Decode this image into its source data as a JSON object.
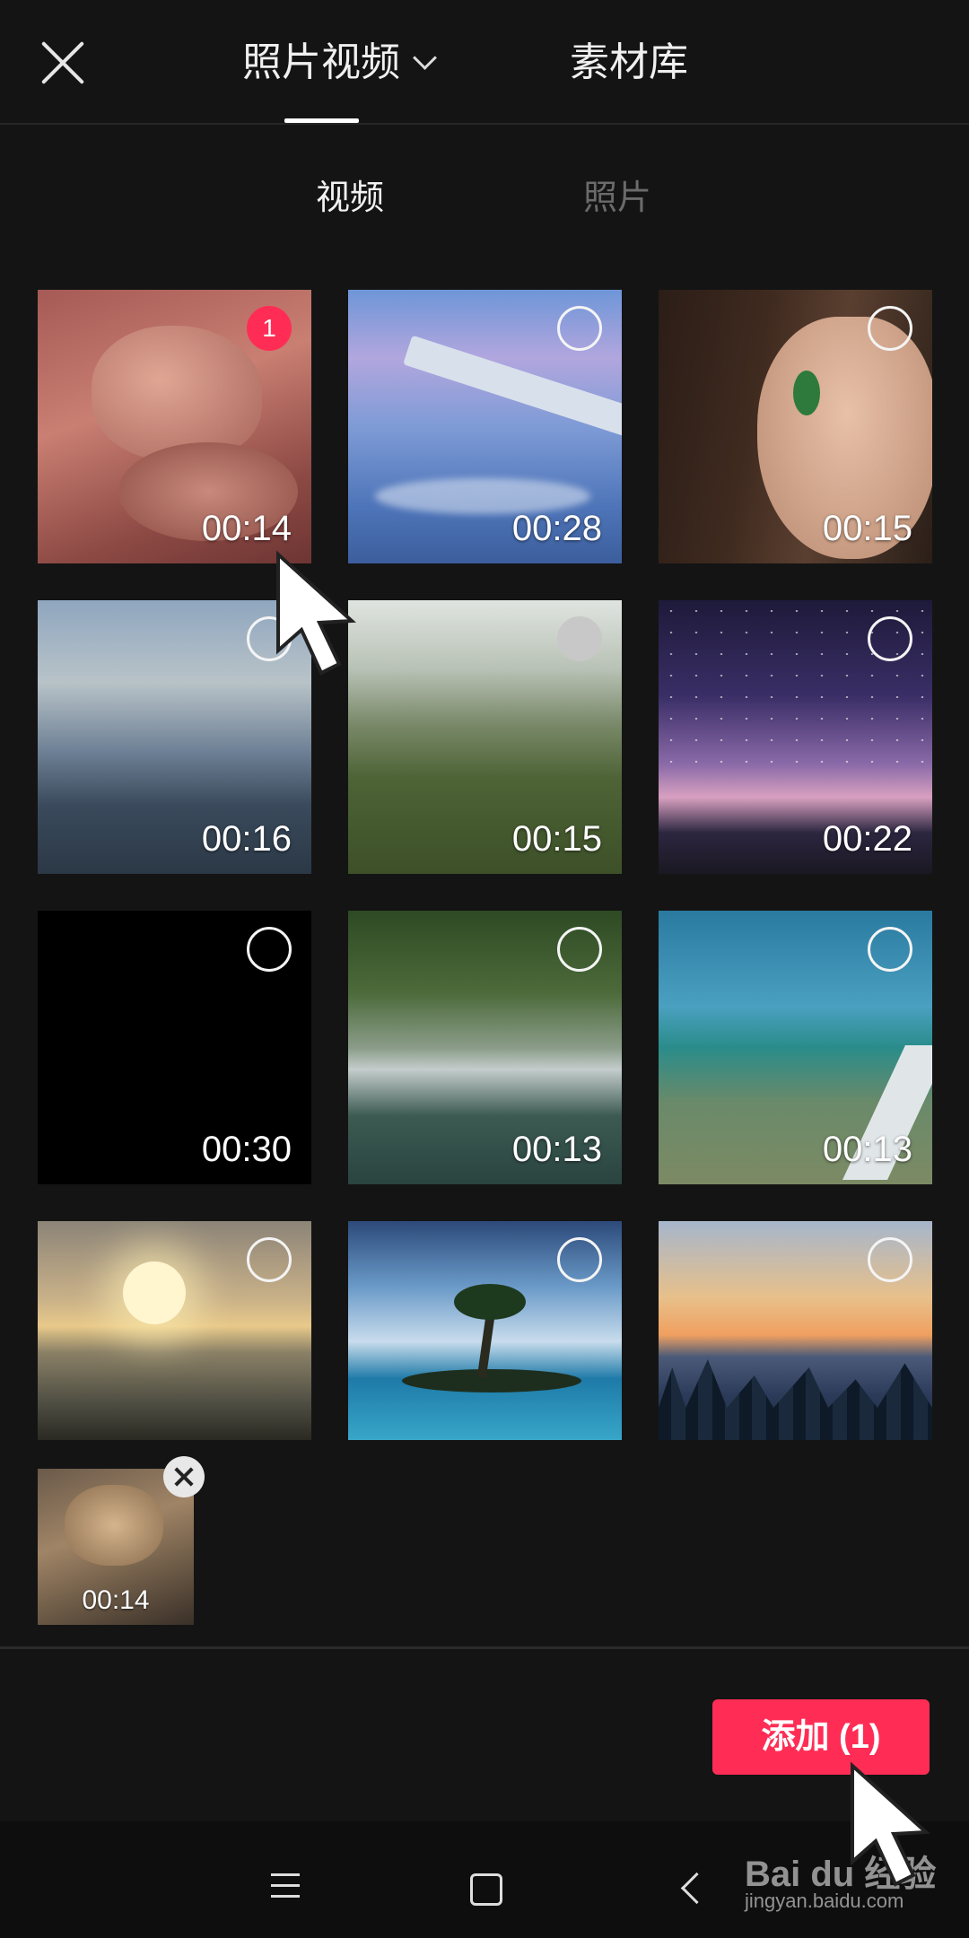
{
  "header": {
    "tabs": [
      {
        "label": "照片视频",
        "active": true
      },
      {
        "label": "素材库",
        "active": false
      }
    ]
  },
  "subtabs": [
    {
      "label": "视频",
      "active": true
    },
    {
      "label": "照片",
      "active": false
    }
  ],
  "media": [
    {
      "duration": "00:14",
      "selected": true,
      "order": "1",
      "scene": "bearded dragon lizard (red tinted, selected)"
    },
    {
      "duration": "00:28",
      "selected": false,
      "scene": "airplane wing above clouds"
    },
    {
      "duration": "00:15",
      "selected": false,
      "scene": "woman with face paint"
    },
    {
      "duration": "00:16",
      "selected": false,
      "scene": "aerial landscape with haze"
    },
    {
      "duration": "00:15",
      "selected": false,
      "scene": "misty green field and hills"
    },
    {
      "duration": "00:22",
      "selected": false,
      "scene": "starry night sky"
    },
    {
      "duration": "00:30",
      "selected": false,
      "scene": "black frame"
    },
    {
      "duration": "00:13",
      "selected": false,
      "scene": "forest waterfall"
    },
    {
      "duration": "00:13",
      "selected": false,
      "scene": "coastline with pier"
    },
    {
      "duration": "",
      "selected": false,
      "scene": "sunset over sea"
    },
    {
      "duration": "",
      "selected": false,
      "scene": "palm island in sea"
    },
    {
      "duration": "",
      "selected": false,
      "scene": "mountains at dusk with pines"
    }
  ],
  "tray": {
    "duration": "00:14"
  },
  "footer": {
    "add_label": "添加 (1)"
  },
  "watermark": {
    "brand": "Bai du 经验",
    "url": "jingyan.baidu.com"
  },
  "colors": {
    "accent": "#ff2d55",
    "background": "#141414"
  }
}
